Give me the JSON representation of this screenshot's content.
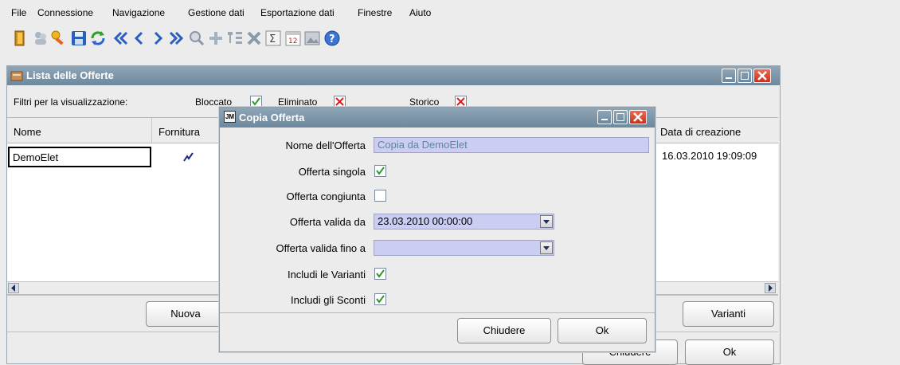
{
  "menubar": {
    "items": [
      "File",
      "Connessione",
      "Navigazione",
      "Gestione dati",
      "Esportazione dati",
      "Finestre",
      "Aiuto"
    ]
  },
  "toolbar": {
    "icons": [
      "exit-icon",
      "users-icon",
      "key-icon",
      "save-icon",
      "refresh-icon",
      "first-icon",
      "previous-icon",
      "next-icon",
      "last-icon",
      "search-icon",
      "add-icon",
      "tree-icon",
      "delete-icon",
      "sum-icon",
      "calendar-icon",
      "image-icon",
      "help-icon"
    ],
    "calendar_text": "12"
  },
  "main_window": {
    "title": "Lista delle Offerte",
    "filters_label": "Filtri per la visualizzazione:",
    "filter_bloccato": "Bloccato",
    "filter_eliminato": "Eliminato",
    "filter_storico": "Storico",
    "columns": [
      "Nome",
      "Fornitura",
      "Data di creazione"
    ],
    "rows": [
      {
        "nome": "DemoElet",
        "data_creazione": "16.03.2010 19:09:09"
      }
    ],
    "buttons": {
      "nuova": "Nuova",
      "varianti": "Varianti",
      "chiudere": "Chiudere",
      "ok": "Ok"
    }
  },
  "dialog": {
    "title": "Copia Offerta",
    "title_icon": "JM",
    "fields": {
      "nome_label": "Nome dell'Offerta",
      "nome_value": "Copia da DemoElet",
      "singola_label": "Offerta singola",
      "singola_checked": true,
      "congiunta_label": "Offerta congiunta",
      "congiunta_checked": false,
      "valida_da_label": "Offerta valida da",
      "valida_da_value": "23.03.2010 00:00:00",
      "valida_fino_label": "Offerta valida fino a",
      "valida_fino_value": "",
      "varianti_label": "Includi le Varianti",
      "varianti_checked": true,
      "sconti_label": "Includi gli Sconti",
      "sconti_checked": true
    },
    "buttons": {
      "chiudere": "Chiudere",
      "ok": "Ok"
    }
  },
  "colors": {
    "titlebar": "#7d94a8",
    "field_bg": "#cbcdf2",
    "check_green": "#2a9a2a",
    "check_red": "#d02020",
    "close_red": "#d8402c"
  }
}
